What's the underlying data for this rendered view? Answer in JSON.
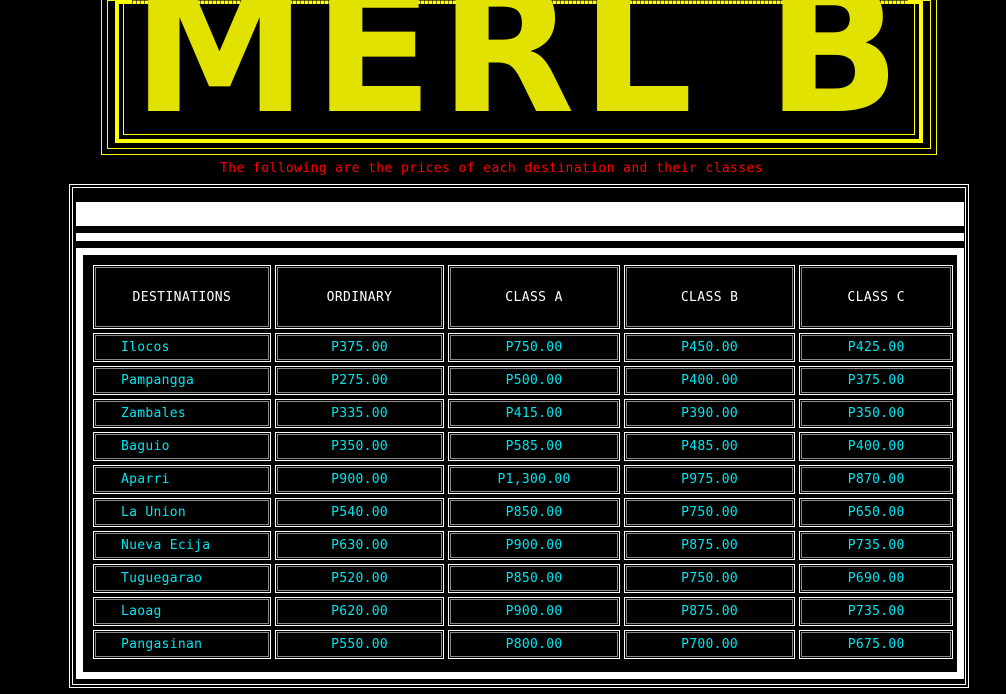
{
  "banner": {
    "title": "MERL BUS"
  },
  "subtitle": "The following are the prices of each destination and their classes",
  "table": {
    "headers": [
      "DESTINATIONS",
      "ORDINARY",
      "CLASS A",
      "CLASS B",
      "CLASS C"
    ],
    "rows": [
      [
        "Ilocos",
        "P375.00",
        "P750.00",
        "P450.00",
        "P425.00"
      ],
      [
        "Pampangga",
        "P275.00",
        "P500.00",
        "P400.00",
        "P375.00"
      ],
      [
        "Zambales",
        "P335.00",
        "P415.00",
        "P390.00",
        "P350.00"
      ],
      [
        "Baguio",
        "P350.00",
        "P585.00",
        "P485.00",
        "P400.00"
      ],
      [
        "Aparri",
        "P900.00",
        "P1,300.00",
        "P975.00",
        "P870.00"
      ],
      [
        "La Union",
        "P540.00",
        "P850.00",
        "P750.00",
        "P650.00"
      ],
      [
        "Nueva Ecija",
        "P630.00",
        "P900.00",
        "P875.00",
        "P735.00"
      ],
      [
        "Tuguegarao",
        "P520.00",
        "P850.00",
        "P750.00",
        "P690.00"
      ],
      [
        "Laoag",
        "P620.00",
        "P900.00",
        "P875.00",
        "P735.00"
      ],
      [
        "Pangasinan",
        "P550.00",
        "P800.00",
        "P700.00",
        "P675.00"
      ]
    ]
  },
  "colors": {
    "background": "#000000",
    "banner": "#ffff00",
    "subtitle": "#ff0000",
    "table_text": "#00e5ee",
    "header_text": "#ffffff"
  }
}
